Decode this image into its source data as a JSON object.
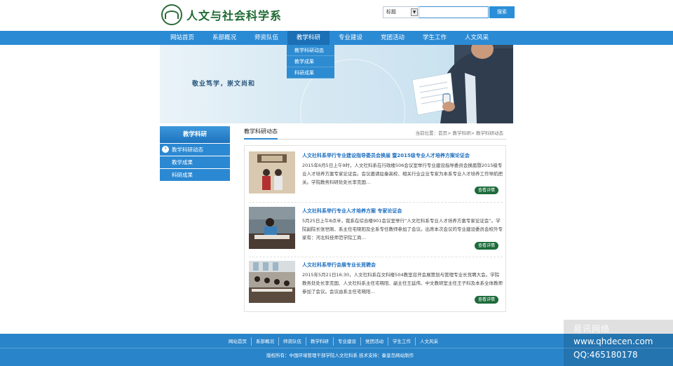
{
  "header": {
    "logo_text": "人文与社会科学系",
    "search_select": "标题",
    "search_button": "搜索"
  },
  "nav": {
    "items": [
      "网站首页",
      "系部概况",
      "师资队伍",
      "教学科研",
      "专业建设",
      "党团活动",
      "学生工作",
      "人文风采"
    ],
    "dropdown": [
      "教学科研动态",
      "教学成果",
      "科研成果"
    ]
  },
  "banner": {
    "slogan": "敬业笃学，崇文尚和"
  },
  "sidebar": {
    "title": "教学科研",
    "items": [
      "教学科研动态",
      "教学成果",
      "科研成果"
    ]
  },
  "content": {
    "title": "教学科研动态",
    "breadcrumb": "当前位置：首页> 教学科研> 教学科研动态",
    "articles": [
      {
        "title": "人文社科系举行专业建设指导委员会换届 暨2015级专业人才培养方案论证会",
        "desc": "2015年6月5日上午9时，人文社科系在行政楼506会议室举行专业建设指导委员会换届暨2015级专业人才培养方案专家论证会。会议邀请驻秦高校、相关行业企业专家为本系专业人才培养工作导航把关。学院教务科研处处长李克国…",
        "more": "查看详情"
      },
      {
        "title": "人文社科系举行专业人才培养方案 专家论证会",
        "desc": "5月25日上午8点半，我系在综合楼901会议室举行“人文社科系专业人才培养方案专家论证会”。学院副院长张世刚、系主任宅晓阳及全系专任教师参加了会议。出席本次会议的专业建设委员会校外专家有：河北科技师范学院工商…",
        "more": "查看详情"
      },
      {
        "title": "人文社科系举行会展专业长竞聘会",
        "desc": "2015年5月21日16:30，人文社科系在文科楼504教室召开会展策划与管理专业长竞聘大会。学院教务处处长李克国、人文社科系主任宅晓阳、副主任王延伟、中文教研室主任王子科及本系全体教师参加了会议。会议由系主任宅晓阳…",
        "more": "查看详情"
      }
    ]
  },
  "footer": {
    "links": [
      "网站首页",
      "系部概况",
      "师资队伍",
      "教学科研",
      "专业建设",
      "党团活动",
      "学生工作",
      "人文风采"
    ],
    "copyright": "版权所有：中国环境管理干部学院人文社科系 技术支持：秦皇岛网站制作"
  },
  "watermark": {
    "line1": "易讯网络",
    "line2": "www.qhdecen.com",
    "line3": "QQ:465180178"
  }
}
